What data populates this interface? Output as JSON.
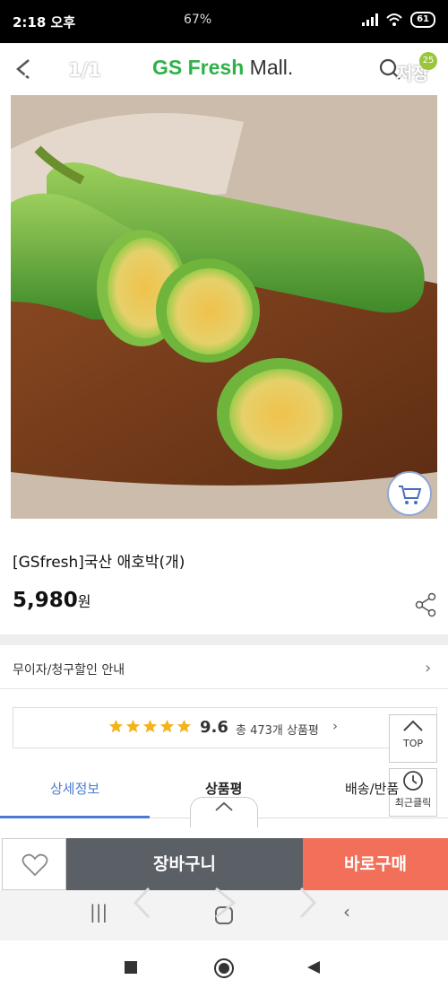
{
  "status_bar": {
    "time": "2:18 오후",
    "middle": "67%",
    "battery": "61"
  },
  "header": {
    "count": "1/1",
    "logo_main": "GS Fresh",
    "logo_suffix": "Mall.",
    "save": "저장",
    "badge": "25"
  },
  "product": {
    "title": "[GSfresh]국산 애호박(개)",
    "price": "5,980",
    "currency": "원"
  },
  "notice": {
    "label": "무이자/청구할인 안내"
  },
  "review": {
    "score": "9.6",
    "count_text": "총 473개 상품평",
    "stars": 5
  },
  "floating": {
    "top_label": "TOP",
    "recent_label": "최근클릭"
  },
  "tabs": [
    {
      "label": "상세정보"
    },
    {
      "label": "상품평"
    },
    {
      "label": "배송/반품"
    }
  ],
  "bottom_bar": {
    "cart_label": "장바구니",
    "buy_label": "바로구매"
  },
  "colors": {
    "brand_green": "#2db24a",
    "tab_active": "#4a7bd1",
    "buy": "#f26f5a",
    "cart": "#5b5f66"
  }
}
